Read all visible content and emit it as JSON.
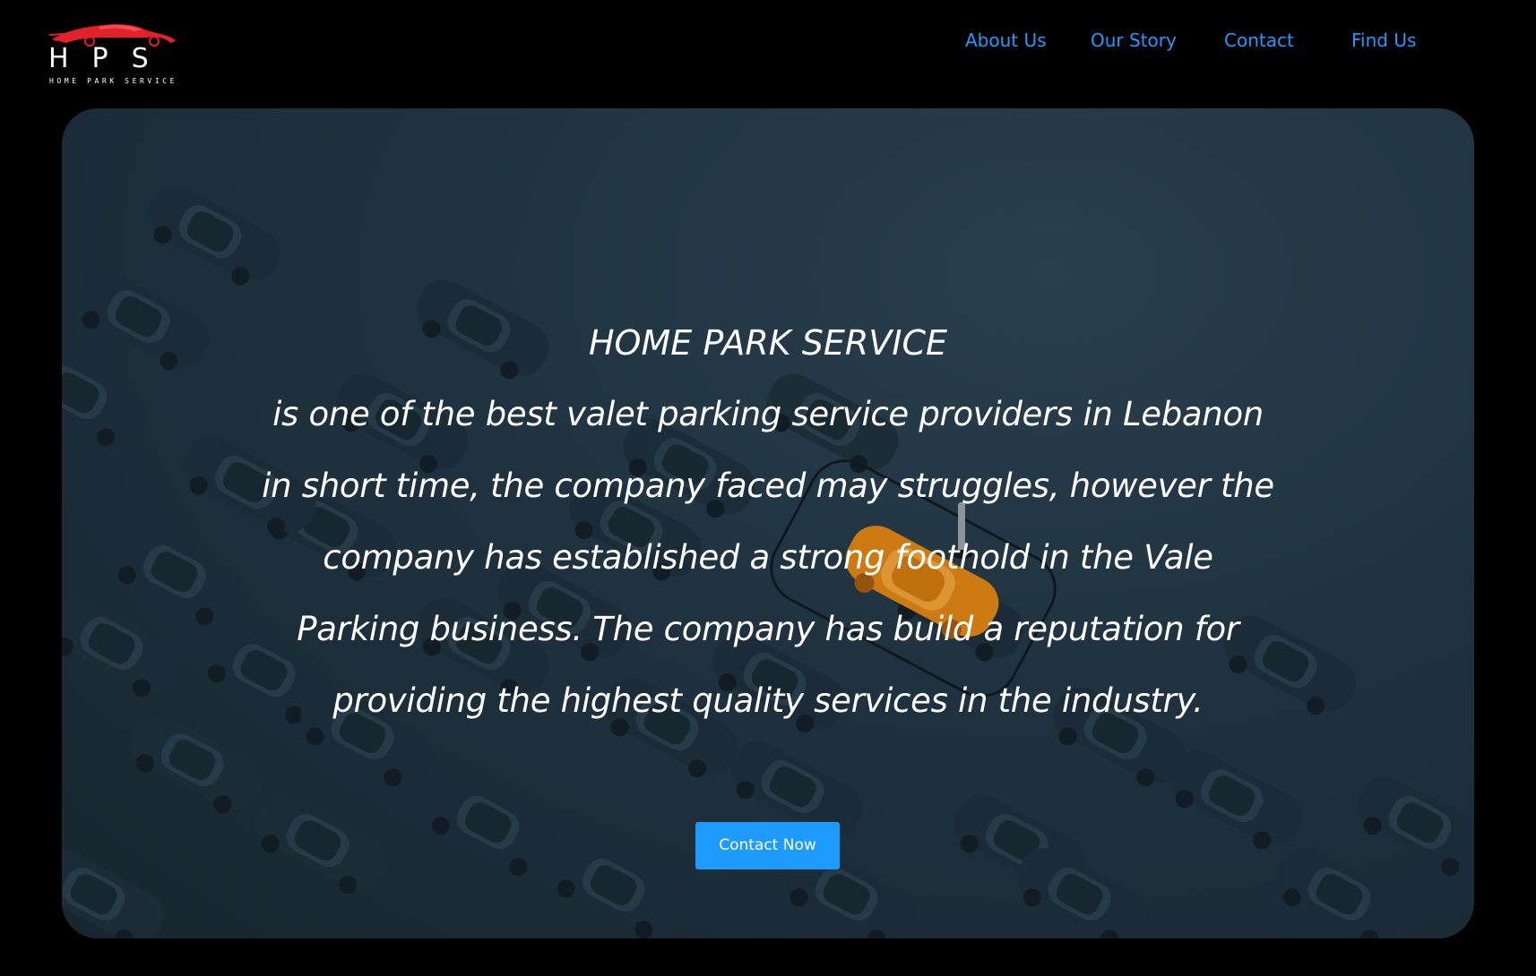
{
  "header": {
    "logo": {
      "letters": "HPS",
      "subtitle": "HOME PARK SERVICE",
      "icon": "sports-car-icon"
    },
    "nav": [
      {
        "label": "About Us"
      },
      {
        "label": "Our Story"
      },
      {
        "label": "Contact"
      },
      {
        "label": "Find Us"
      }
    ]
  },
  "hero": {
    "title": "HOME PARK SERVICE",
    "lines": [
      "is one of the best valet parking service providers in Lebanon",
      "in short time, the company faced may struggles, however the",
      "company has established a strong foothold in the Vale",
      "Parking business. The company has build a reputation for",
      "providing the highest quality services in the industry."
    ],
    "cta_label": "Contact Now",
    "background_image": "parking-lot-cars-with-orange-car"
  },
  "colors": {
    "background": "#000000",
    "accent": "#1e9bff",
    "logo_red": "#e3212b",
    "hero_overlay": "#213543",
    "highlight_car": "#f2921a"
  }
}
